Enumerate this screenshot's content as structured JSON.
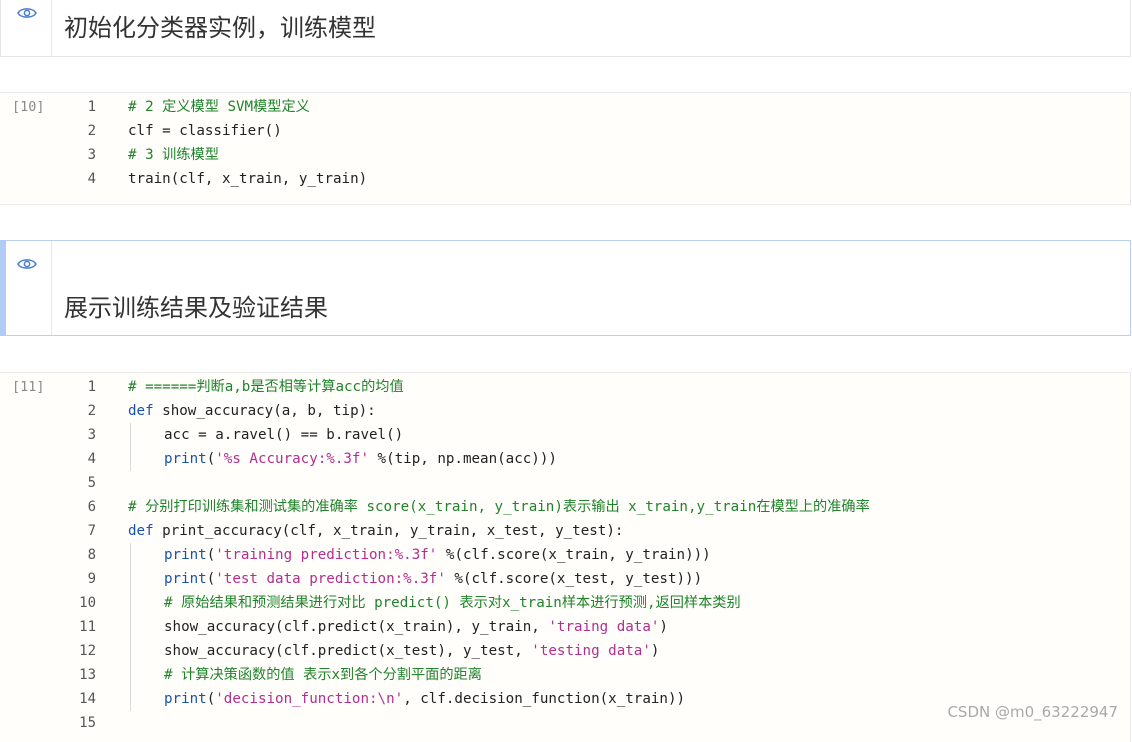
{
  "cells": [
    {
      "type": "markdown",
      "title": "初始化分类器实例，训练模型"
    },
    {
      "type": "code",
      "exec_count": "[10]",
      "lines": [
        {
          "num": "1",
          "text": "# 2 定义模型 SVM模型定义"
        },
        {
          "num": "2",
          "text": "clf = classifier()"
        },
        {
          "num": "3",
          "text": "# 3 训练模型"
        },
        {
          "num": "4",
          "text": "train(clf, x_train, y_train)"
        }
      ]
    },
    {
      "type": "markdown",
      "title": "展示训练结果及验证结果",
      "selected": true
    },
    {
      "type": "code",
      "exec_count": "[11]",
      "lines": [
        {
          "num": "1",
          "text": "# ======判断a,b是否相等计算acc的均值"
        },
        {
          "num": "2",
          "text": "def show_accuracy(a, b, tip):"
        },
        {
          "num": "3",
          "text": "acc = a.ravel() == b.ravel()"
        },
        {
          "num": "4",
          "text": "print('%s Accuracy:%.3f' %(tip, np.mean(acc)))"
        },
        {
          "num": "5",
          "text": ""
        },
        {
          "num": "6",
          "text": "# 分别打印训练集和测试集的准确率 score(x_train, y_train)表示输出 x_train,y_train在模型上的准确率"
        },
        {
          "num": "7",
          "text": "def print_accuracy(clf, x_train, y_train, x_test, y_test):"
        },
        {
          "num": "8",
          "text": "print('training prediction:%.3f' %(clf.score(x_train, y_train)))"
        },
        {
          "num": "9",
          "text": "print('test data prediction:%.3f' %(clf.score(x_test, y_test)))"
        },
        {
          "num": "10",
          "text": "# 原始结果和预测结果进行对比 predict() 表示对x_train样本进行预测,返回样本类别"
        },
        {
          "num": "11",
          "text": "show_accuracy(clf.predict(x_train), y_train, 'traing data')"
        },
        {
          "num": "12",
          "text": "show_accuracy(clf.predict(x_test), y_test, 'testing data')"
        },
        {
          "num": "13",
          "text": "# 计算决策函数的值 表示x到各个分割平面的距离"
        },
        {
          "num": "14",
          "text": "print('decision_function:\\n', clf.decision_function(x_train))"
        },
        {
          "num": "15",
          "text": ""
        }
      ]
    }
  ],
  "watermark": "CSDN @m0_63222947",
  "colors": {
    "comment": "#20842b",
    "keyword": "#1a50b0",
    "string": "#b22f8f",
    "selected_bar": "#b3ccf5"
  },
  "icons": [
    "eye-icon"
  ]
}
